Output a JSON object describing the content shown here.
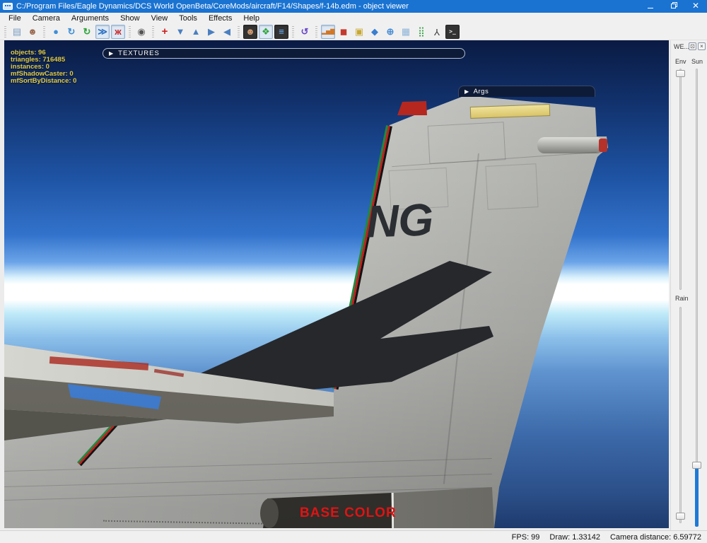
{
  "window": {
    "title": "C:/Program Files/Eagle Dynamics/DCS World OpenBeta/CoreMods/aircraft/F14/Shapes/f-14b.edm - object viewer"
  },
  "menu": {
    "items": [
      "File",
      "Camera",
      "Arguments",
      "Show",
      "View",
      "Tools",
      "Effects",
      "Help"
    ]
  },
  "toolbar": {
    "icons": [
      {
        "name": "open-file",
        "glyph": "▤"
      },
      {
        "name": "person-add",
        "glyph": "☻"
      },
      {
        "name": "sphere",
        "glyph": "●"
      },
      {
        "name": "refresh",
        "glyph": "↻"
      },
      {
        "name": "reload",
        "glyph": "↻"
      },
      {
        "name": "playback",
        "glyph": "≫"
      },
      {
        "name": "running-man",
        "glyph": "ж"
      },
      {
        "name": "camera",
        "glyph": "◉"
      },
      {
        "name": "crosshair",
        "glyph": "+"
      },
      {
        "name": "cone-down",
        "glyph": "▼"
      },
      {
        "name": "cone-up",
        "glyph": "▲"
      },
      {
        "name": "step-forward",
        "glyph": "▶"
      },
      {
        "name": "step-back",
        "glyph": "◀"
      },
      {
        "name": "portrait",
        "glyph": "☻"
      },
      {
        "name": "shapes",
        "glyph": "❖"
      },
      {
        "name": "layers",
        "glyph": "≡"
      },
      {
        "name": "rotate-ccw",
        "glyph": "↺"
      },
      {
        "name": "bar-chart",
        "glyph": "▂▅▇"
      },
      {
        "name": "cube",
        "glyph": "◼"
      },
      {
        "name": "box-wireframe",
        "glyph": "▣"
      },
      {
        "name": "gem",
        "glyph": "◆"
      },
      {
        "name": "axis-sphere",
        "glyph": "⊕"
      },
      {
        "name": "grid",
        "glyph": "▦"
      },
      {
        "name": "dot-grid",
        "glyph": "⣿"
      },
      {
        "name": "tripod",
        "glyph": "Y"
      },
      {
        "name": "console",
        "glyph": ">_"
      }
    ]
  },
  "viewport": {
    "stats": [
      "objects: 96",
      "triangles: 716485",
      "instances: 0",
      "mfShadowCaster: 0",
      "mfSortByDistance: 0"
    ],
    "textures_panel": {
      "arrow": "▶",
      "label": "TEXTURES"
    },
    "args_panel": {
      "arrow": "▶",
      "label": "Args"
    },
    "model": {
      "tail_code": "NG",
      "nozzle_label": "BASE COLOR"
    }
  },
  "right_panel": {
    "title": "WE...",
    "float_icon": "⊡",
    "close_icon": "×",
    "sliders": {
      "env": "Env",
      "sun": "Sun",
      "rain": "Rain"
    }
  },
  "status": {
    "fps": "FPS: 99",
    "draw": "Draw: 1.33142",
    "camera": "Camera distance: 6.59772"
  },
  "colors": {
    "accent": "#1a73d1",
    "stats-yellow": "#e2cc49",
    "base-red": "#e01313",
    "sun-blue": "#1e7ad6",
    "panel-navy": "#0e1b38"
  }
}
